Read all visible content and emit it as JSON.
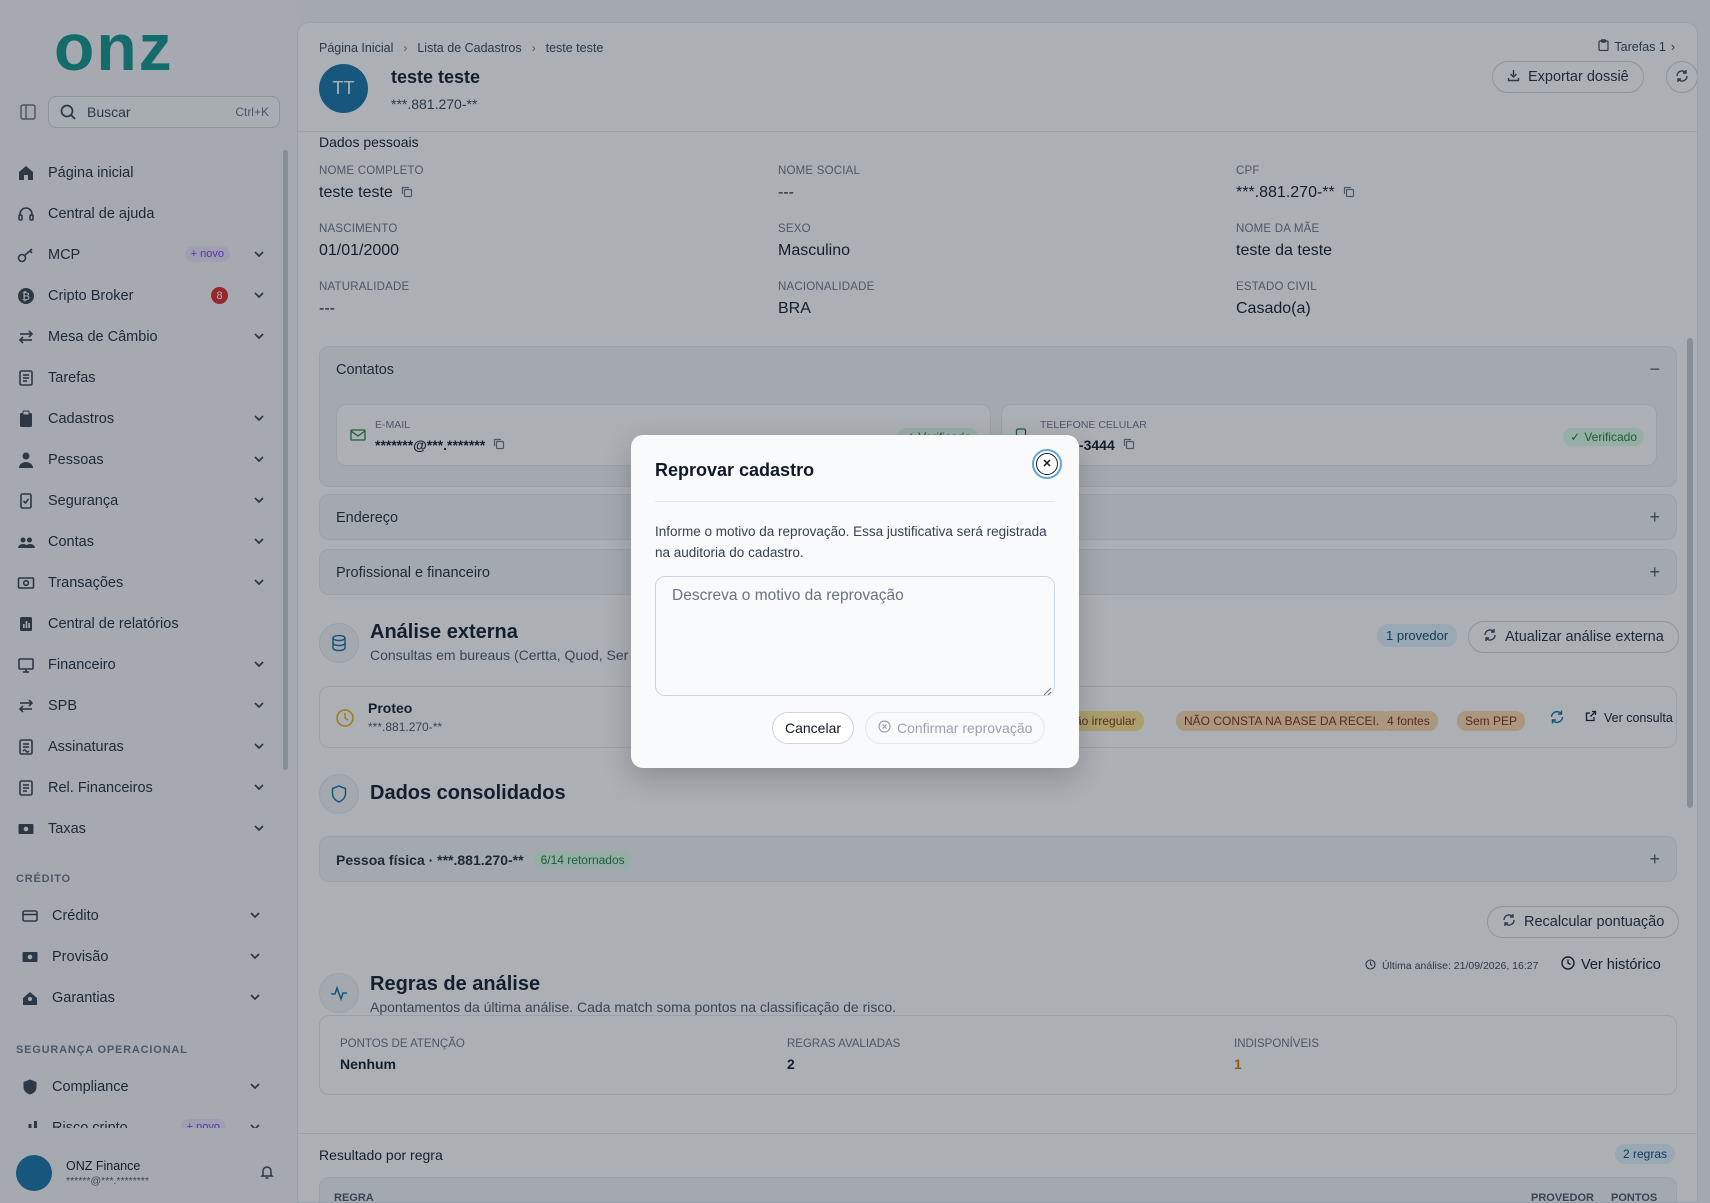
{
  "app": {
    "brand": "onz"
  },
  "sidebar": {
    "search_label": "Buscar",
    "search_shortcut": "Ctrl+K",
    "items": [
      {
        "label": "Página inicial",
        "icon": "home-icon"
      },
      {
        "label": "Central de ajuda",
        "icon": "headset-icon"
      },
      {
        "label": "MCP",
        "icon": "key-icon",
        "badge": "+ novo"
      },
      {
        "label": "Cripto Broker",
        "icon": "bitcoin-icon",
        "count": "8"
      },
      {
        "label": "Mesa de Câmbio",
        "icon": "arrows-icon"
      },
      {
        "label": "Tarefas",
        "icon": "tasks-icon"
      },
      {
        "label": "Cadastros",
        "icon": "clipboard-icon"
      },
      {
        "label": "Pessoas",
        "icon": "person-icon"
      },
      {
        "label": "Segurança",
        "icon": "shield-check-icon"
      },
      {
        "label": "Contas",
        "icon": "users-icon"
      },
      {
        "label": "Transações",
        "icon": "cash-icon"
      },
      {
        "label": "Central de relatórios",
        "icon": "report-icon"
      },
      {
        "label": "Financeiro",
        "icon": "monitor-icon"
      },
      {
        "label": "SPB",
        "icon": "arrows-icon"
      },
      {
        "label": "Assinaturas",
        "icon": "signature-icon"
      },
      {
        "label": "Rel. Financeiros",
        "icon": "file-icon"
      },
      {
        "label": "Taxas",
        "icon": "cash-icon"
      }
    ],
    "credit_section": "CRÉDITO",
    "credit_items": [
      {
        "label": "Crédito",
        "icon": "card-icon"
      },
      {
        "label": "Provisão",
        "icon": "cash-icon"
      },
      {
        "label": "Garantias",
        "icon": "house-user-icon"
      }
    ],
    "ops_section": "SEGURANÇA OPERACIONAL",
    "ops_items": [
      {
        "label": "Compliance",
        "icon": "shield-icon"
      },
      {
        "label": "Risco cripto",
        "icon": "chart-icon",
        "badge": "+ novo"
      }
    ],
    "user": {
      "name": "ONZ Finance",
      "email": "******@***.********"
    }
  },
  "header": {
    "breadcrumb": [
      "Página Inicial",
      "Lista de Cadastros",
      "teste teste"
    ],
    "tasks_label": "Tarefas 1",
    "avatar_initials": "TT",
    "name": "teste teste",
    "document": "***.881.270-**",
    "export_label": "Exportar dossiê"
  },
  "personal": {
    "title": "Dados pessoais",
    "fields": [
      {
        "label": "NOME COMPLETO",
        "value": "teste teste"
      },
      {
        "label": "NOME SOCIAL",
        "value": "---"
      },
      {
        "label": "CPF",
        "value": "***.881.270-**"
      },
      {
        "label": "NASCIMENTO",
        "value": "01/01/2000"
      },
      {
        "label": "SEXO",
        "value": "Masculino"
      },
      {
        "label": "NOME DA MÃE",
        "value": "teste da teste"
      },
      {
        "label": "NATURALIDADE",
        "value": "---"
      },
      {
        "label": "NACIONALIDADE",
        "value": "BRA"
      },
      {
        "label": "ESTADO CIVIL",
        "value": "Casado(a)"
      }
    ]
  },
  "contacts": {
    "title": "Contatos",
    "email_label": "E-MAIL",
    "email_value": "*******@***.*******",
    "phone_label": "TELEFONE CELULAR",
    "phone_value": "12342-3444",
    "verified": "Verificado"
  },
  "address": {
    "title": "Endereço"
  },
  "professional": {
    "title": "Profissional e financeiro"
  },
  "external": {
    "title": "Análise externa",
    "subtitle": "Consultas em bureaus (Certta, Quod, Ser",
    "providers_pill": "1 provedor",
    "update_label": "Atualizar análise externa",
    "provider_name": "Proteo",
    "provider_doc": "***.881.270-**",
    "tags": [
      "ão irregular",
      "NÃO CONSTA NA BASE DA RECEI..",
      "4 fontes",
      "Sem PEP"
    ],
    "view_label": "Ver consulta"
  },
  "consolidated": {
    "title": "Dados consolidados",
    "row_label": "Pessoa física · ***.881.270-**",
    "returned": "6/14 retornados"
  },
  "rules": {
    "recalc_label": "Recalcular pontuação",
    "title": "Regras de análise",
    "subtitle": "Apontamentos da última análise. Cada match soma pontos na classificação de risco.",
    "last_analysis": "Última análise: 21/09/2026, 16:27",
    "history_label": "Ver histórico",
    "stats": [
      {
        "label": "PONTOS DE ATENÇÃO",
        "value": "Nenhum"
      },
      {
        "label": "REGRAS AVALIADAS",
        "value": "2"
      },
      {
        "label": "INDISPONÍVEIS",
        "value": "1"
      }
    ],
    "results_title": "Resultado por regra",
    "results_count": "2 regras",
    "col_rule": "REGRA",
    "col_provider": "PROVEDOR",
    "col_points": "PONTOS"
  },
  "modal": {
    "title": "Reprovar cadastro",
    "description": "Informe o motivo da reprovação. Essa justificativa será registrada na auditoria do cadastro.",
    "placeholder": "Descreva o motivo da reprovação",
    "value": "",
    "cancel_label": "Cancelar",
    "confirm_label": "Confirmar reprovação"
  },
  "colors": {
    "brand": "#0d9488",
    "accent": "#1673a6",
    "verified": "#15803d"
  }
}
